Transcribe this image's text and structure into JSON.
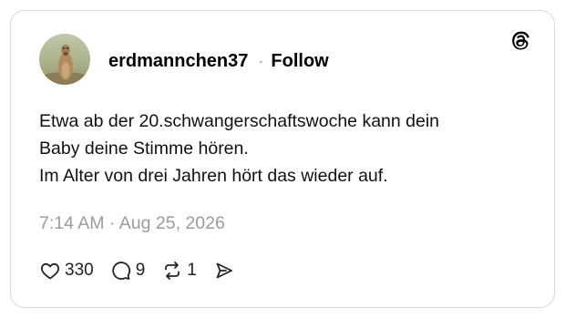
{
  "post": {
    "username": "erdmannchen37",
    "separator": "·",
    "follow_label": "Follow",
    "text_lines": [
      "Etwa ab der 20.schwangerschaftswoche kann dein",
      "Baby deine Stimme hören.",
      "Im Alter von drei Jahren hört das wieder auf."
    ],
    "timestamp": "7:14 AM · Aug 25, 2026",
    "likes": "330",
    "replies": "9",
    "reposts": "1"
  },
  "icons": {
    "brand": "threads-logo-icon",
    "like": "heart-icon",
    "reply": "comment-bubble-icon",
    "repost": "repost-icon",
    "share": "send-icon"
  },
  "colors": {
    "text": "#000000",
    "muted": "#9b9b9b",
    "border": "#d9d9d9",
    "background": "#ffffff"
  }
}
